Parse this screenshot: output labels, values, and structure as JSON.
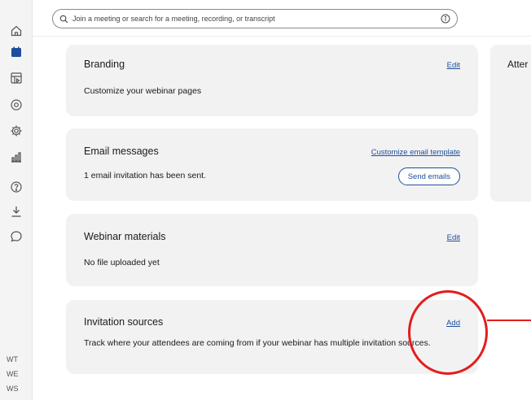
{
  "sidebar": {
    "icons": [
      "home-icon",
      "calendar-icon",
      "recordings-icon",
      "webex-circle-icon",
      "settings-icon",
      "analytics-icon",
      "help-icon",
      "download-icon",
      "chat-icon"
    ],
    "labels": [
      "WT",
      "WE",
      "WS"
    ]
  },
  "search": {
    "placeholder": "Join a meeting or search for a meeting, recording, or transcript"
  },
  "cards": {
    "branding": {
      "title": "Branding",
      "desc": "Customize your webinar pages",
      "link": "Edit"
    },
    "email": {
      "title": "Email messages",
      "desc": "1 email invitation has been sent.",
      "link": "Customize email template",
      "button": "Send emails"
    },
    "materials": {
      "title": "Webinar materials",
      "desc": "No file uploaded yet",
      "link": "Edit"
    },
    "invitation": {
      "title": "Invitation sources",
      "desc": "Track where your attendees are coming from if your webinar has multiple invitation sources.",
      "link": "Add"
    }
  },
  "side_panel": {
    "title": "Atter"
  },
  "colors": {
    "accent": "#1b4f9c",
    "annotation": "#e31d1d",
    "card_bg": "#f2f2f2"
  }
}
